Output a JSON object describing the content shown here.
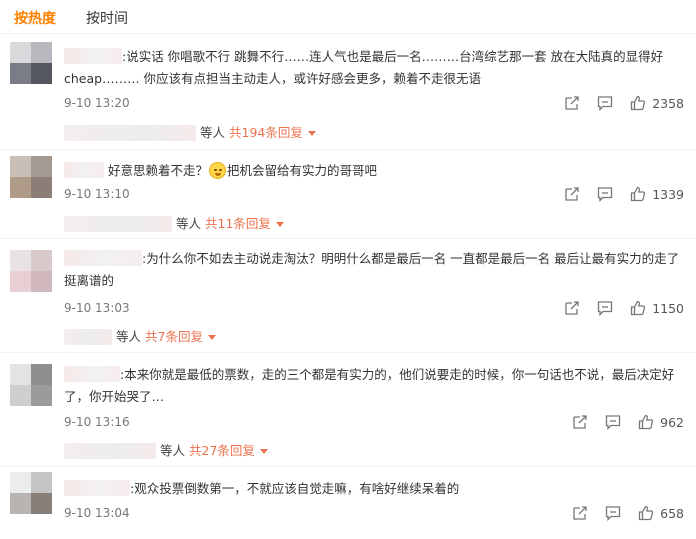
{
  "tabs": {
    "hot": "按热度",
    "time": "按时间"
  },
  "colors": {
    "accent": "#ff8200",
    "reply": "#eb7350"
  },
  "comments": [
    {
      "text": ":说实话 你唱歌不行 跳舞不行……连人气也是最后一名………台湾综艺那一套 放在大陆真的显得好cheap……… 你应该有点担当主动走人，或许好感会更多，赖着不走很无语",
      "time": "9-10 13:20",
      "likes": "2358",
      "reply_prefix": "等人",
      "reply_count": "共194条回复"
    },
    {
      "text_a": "好意思赖着不走？",
      "text_b": "把机会留给有实力的哥哥吧",
      "time": "9-10 13:10",
      "likes": "1339",
      "reply_prefix": "等人",
      "reply_count": "共11条回复"
    },
    {
      "text": ":为什么你不如去主动说走淘汰？明明什么都是最后一名 一直都是最后一名 最后让最有实力的走了 挺离谱的",
      "time": "9-10 13:03",
      "likes": "1150",
      "reply_prefix": "等人",
      "reply_count": "共7条回复"
    },
    {
      "text": ":本来你就是最低的票数，走的三个都是有实力的，他们说要走的时候，你一句话也不说，最后决定好了，你开始哭了…",
      "time": "9-10 13:16",
      "likes": "962",
      "reply_prefix": "等人",
      "reply_count": "共27条回复"
    },
    {
      "text": ":观众投票倒数第一，不就应该自觉走嘛，有啥好继续呆着的",
      "time": "9-10 13:04",
      "likes": "658"
    }
  ],
  "icons": {
    "share": "share-icon",
    "comment": "comment-icon",
    "like": "thumbs-up-icon",
    "emoji": "sleepy-face-emoji"
  }
}
